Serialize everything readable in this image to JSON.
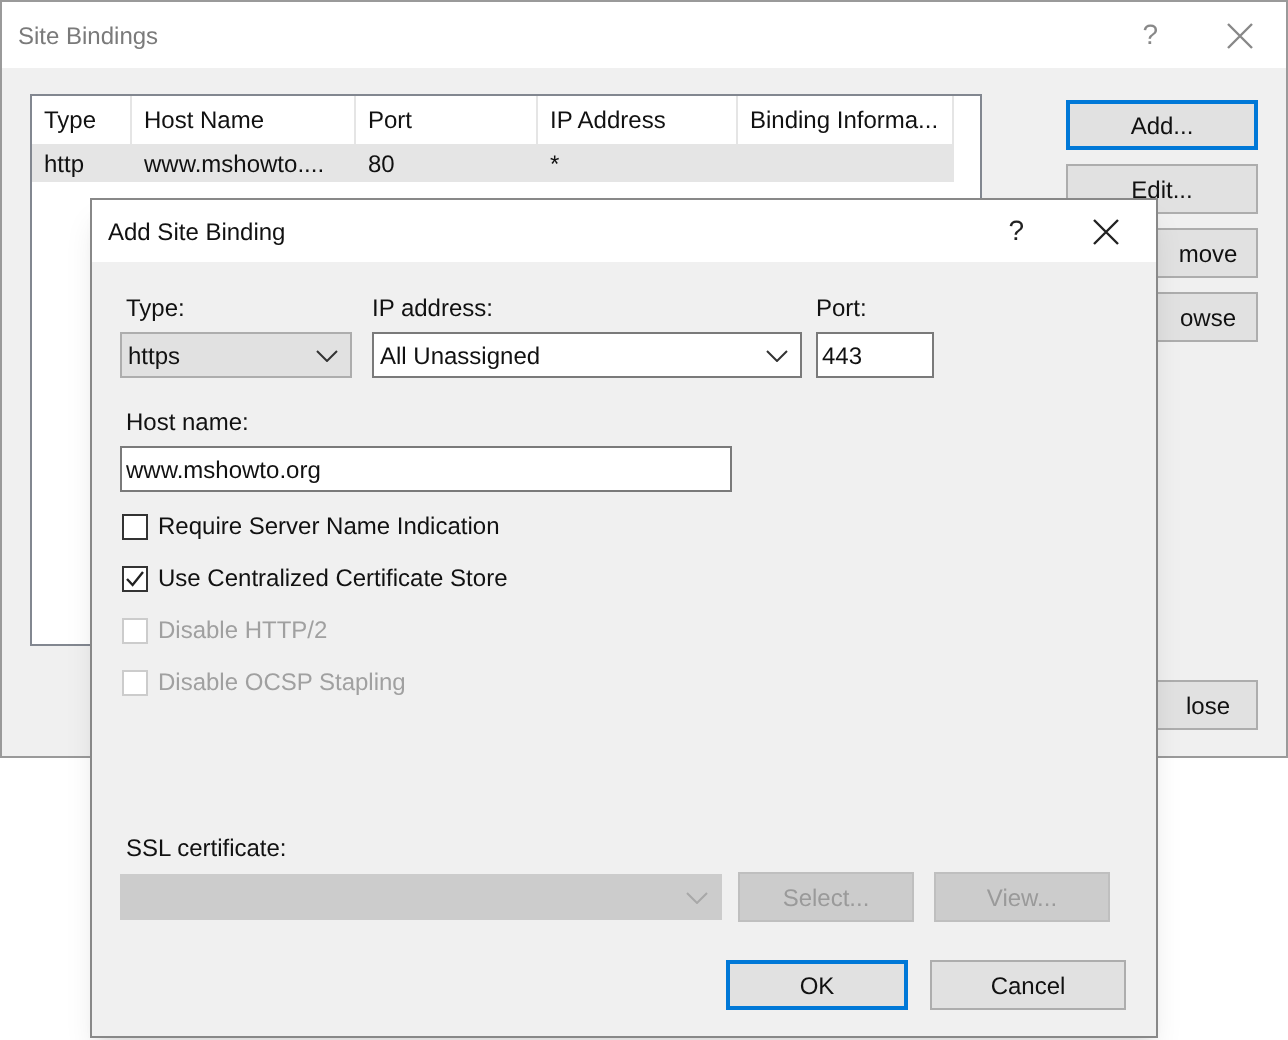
{
  "site_bindings": {
    "title": "Site Bindings",
    "help": "?",
    "table": {
      "columns": [
        "Type",
        "Host Name",
        "Port",
        "IP Address",
        "Binding Informa..."
      ],
      "rows": [
        {
          "cells": [
            "http",
            "www.mshowto....",
            "80",
            "*",
            ""
          ],
          "selected": true
        }
      ]
    },
    "buttons": [
      {
        "label": "Add...",
        "focused": true
      },
      {
        "label": "Edit...",
        "focused": false
      },
      {
        "label": "move",
        "focused": false
      },
      {
        "label": "owse",
        "focused": false
      },
      {
        "label": "lose",
        "focused": false
      }
    ]
  },
  "add_site_binding": {
    "title": "Add Site Binding",
    "help": "?",
    "type": {
      "label": "Type:",
      "value": "https"
    },
    "ip_address": {
      "label": "IP address:",
      "value": "All Unassigned"
    },
    "port": {
      "label": "Port:",
      "value": "443"
    },
    "host_name": {
      "label": "Host name:",
      "value": "www.mshowto.org"
    },
    "checkboxes": [
      {
        "label": "Require Server Name Indication",
        "checked": false,
        "disabled": false
      },
      {
        "label": "Use Centralized Certificate Store",
        "checked": true,
        "disabled": false
      },
      {
        "label": "Disable HTTP/2",
        "checked": false,
        "disabled": true
      },
      {
        "label": "Disable OCSP Stapling",
        "checked": false,
        "disabled": true
      }
    ],
    "ssl_certificate": {
      "label": "SSL certificate:",
      "disabled": true
    },
    "ssl_buttons": [
      {
        "label": "Select...",
        "disabled": true
      },
      {
        "label": "View...",
        "disabled": true
      }
    ],
    "footer_buttons": [
      {
        "label": "OK",
        "focused": true
      },
      {
        "label": "Cancel",
        "focused": false
      }
    ]
  }
}
